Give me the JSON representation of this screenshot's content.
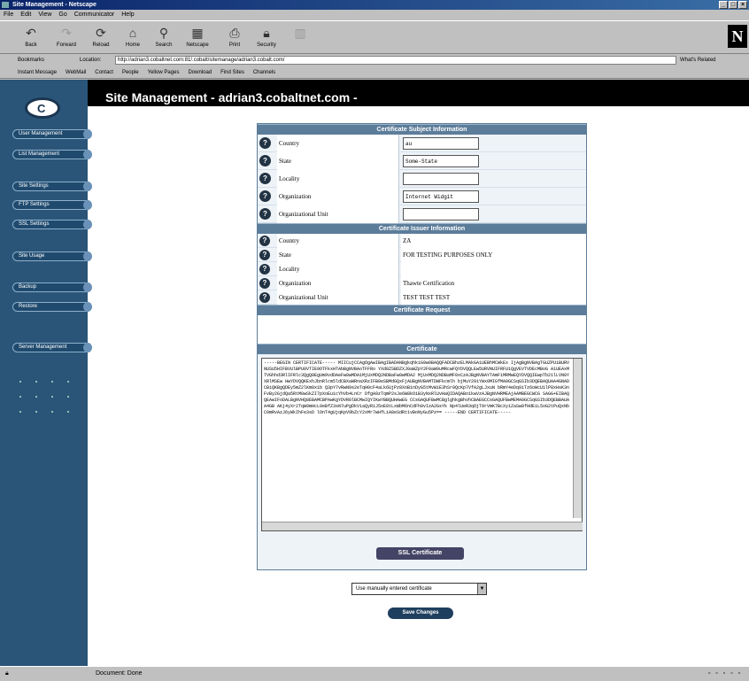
{
  "window": {
    "title": "Site Management - Netscape"
  },
  "menu": [
    "File",
    "Edit",
    "View",
    "Go",
    "Communicator",
    "Help"
  ],
  "toolbar": [
    {
      "label": "Back",
      "icon": "back-icon"
    },
    {
      "label": "Forward",
      "icon": "forward-icon"
    },
    {
      "label": "Reload",
      "icon": "reload-icon"
    },
    {
      "label": "Home",
      "icon": "home-icon"
    },
    {
      "label": "Search",
      "icon": "search-icon"
    },
    {
      "label": "Netscape",
      "icon": "netscape-icon"
    },
    {
      "label": "Print",
      "icon": "print-icon"
    },
    {
      "label": "Security",
      "icon": "security-icon"
    },
    {
      "label": "",
      "icon": "stop-icon"
    }
  ],
  "location": {
    "bookmarks": "Bookmarks",
    "label": "Location:",
    "url": "http://adrian3.cobaltnet.com:81/.cobalt/sitemanage/adrian3.cobalt.com/",
    "whats_related": "What's Related"
  },
  "personal": [
    "Instant Message",
    "WebMail",
    "Contact",
    "People",
    "Yellow Pages",
    "Download",
    "Find Sites",
    "Channels"
  ],
  "page": {
    "title": "Site Management - adrian3.cobaltnet.com -"
  },
  "sidebar": {
    "items": [
      "User Management",
      "List Management",
      "Site Settings",
      "FTP Settings",
      "SSL Settings",
      "Site Usage",
      "Backup",
      "Restore",
      "Server Management"
    ]
  },
  "subject": {
    "header": "Certificate Subject Information",
    "rows": [
      {
        "label": "Country",
        "value": "au"
      },
      {
        "label": "State",
        "value": "Some-State"
      },
      {
        "label": "Locality",
        "value": ""
      },
      {
        "label": "Organization",
        "value": "Internet Widgit"
      },
      {
        "label": "Organizational Unit",
        "value": ""
      }
    ]
  },
  "issuer": {
    "header": "Certificate Issuer Information",
    "rows": [
      {
        "label": "Country",
        "value": "ZA"
      },
      {
        "label": "State",
        "value": "FOR TESTING PURPOSES ONLY"
      },
      {
        "label": "Locality",
        "value": ""
      },
      {
        "label": "Organization",
        "value": "Thawte Certification"
      },
      {
        "label": "Organizational Unit",
        "value": "TEST TEST TEST"
      }
    ]
  },
  "request": {
    "header": "Certificate Request"
  },
  "certificate": {
    "header": "Certificate",
    "text": "-----BEGIN CERTIFICATE----- MIICujCCAgOgAwIBAgIBADANBgkqhkiG9w0BAQQFADCBhzELMAkGA1UEBhMCWkEx IjAgBgNVBAgTGUZPUiBURVNUSU5HIFBVUlBPU0VTIE9OTFkxHTAbBgNVBAoTFFRo YXd0ZSBDZXJ0aWZpY2F0aW9uMRcwFQYDVQQLEw5URVNUIFRFU1QgVEVTVDEcMBoG A1UEAxMTVGhhd3RlIFRlc3QgQ0EgUm9vdDAeFw0wMDA1MjUxMDQ2NDBaFw0wMDA2 MjUxMDQ2NDBaMF0xCzAJBgNVBAYTAmF1MRMwEQYDVQQIEwpTb21lLVN0YXRlMSEw HwYDVQQKExhJbnRlcm5ldCBXaWRnaXRzIFB0eSBMdGQxFjAUBgNVBAMTDWFkcmlh bjMuY29iYWx0MIGfMA0GCSqGSIb3DQEBAQUAA4GNADCBiQKBgQDEy5mZ2lKm8x1b Q3pY7vRwN9s2eTqH0cF4aLk6UjPz8XoB1nDyG5tMvWiE3hSr0QcKp7VfA2gLJxuN bRmY4eDq9iTz6oWcU1lP8xHsK3nFvBy2GjdQa5RtM0wSkZI7pXoEu1cYhVb4LnCr DfgA9zTqmP2sJe6W8kOiB3yNxRlUvHaQIDAQABo1kwVzAJBgNVHRMEAjAAMBEGCWCG SAGG+EIBAQQEAwIFoDALBgNVHQ8EBAMCBPAwKgYDVR0lBCMwIQYIKwYBBQUHAwEG CCsGAQUFBwMCBglghkgBhvhCBAEGCCsGAQUFBwMEMA0GCSqGSIb3DQEBBAUAA4GB AKj4yXr2TqW9mHcL0eBfZ3sN7uPgDkV1aQyRiJ5oE8tLxWbM6nCdFh0vIzA2GsYk Np4lUeR3qOjT9rVmK7BcXy1ZaSw8fHdEiL5oG2tPuQxNbC0mRvAzJ6yWkIhFe3sD lOnT4gUjqKpV9bZcY2xMr7wHfLiA8eSdRt1vBoNyGu5Pz== -----END CERTIFICATE-----"
  },
  "cert_button": {
    "label": "SSL Certificate"
  },
  "select": {
    "value": "Use manually entered certificate"
  },
  "save": {
    "label": "Save Changes"
  },
  "status": {
    "security": "",
    "text": "Document: Done"
  }
}
